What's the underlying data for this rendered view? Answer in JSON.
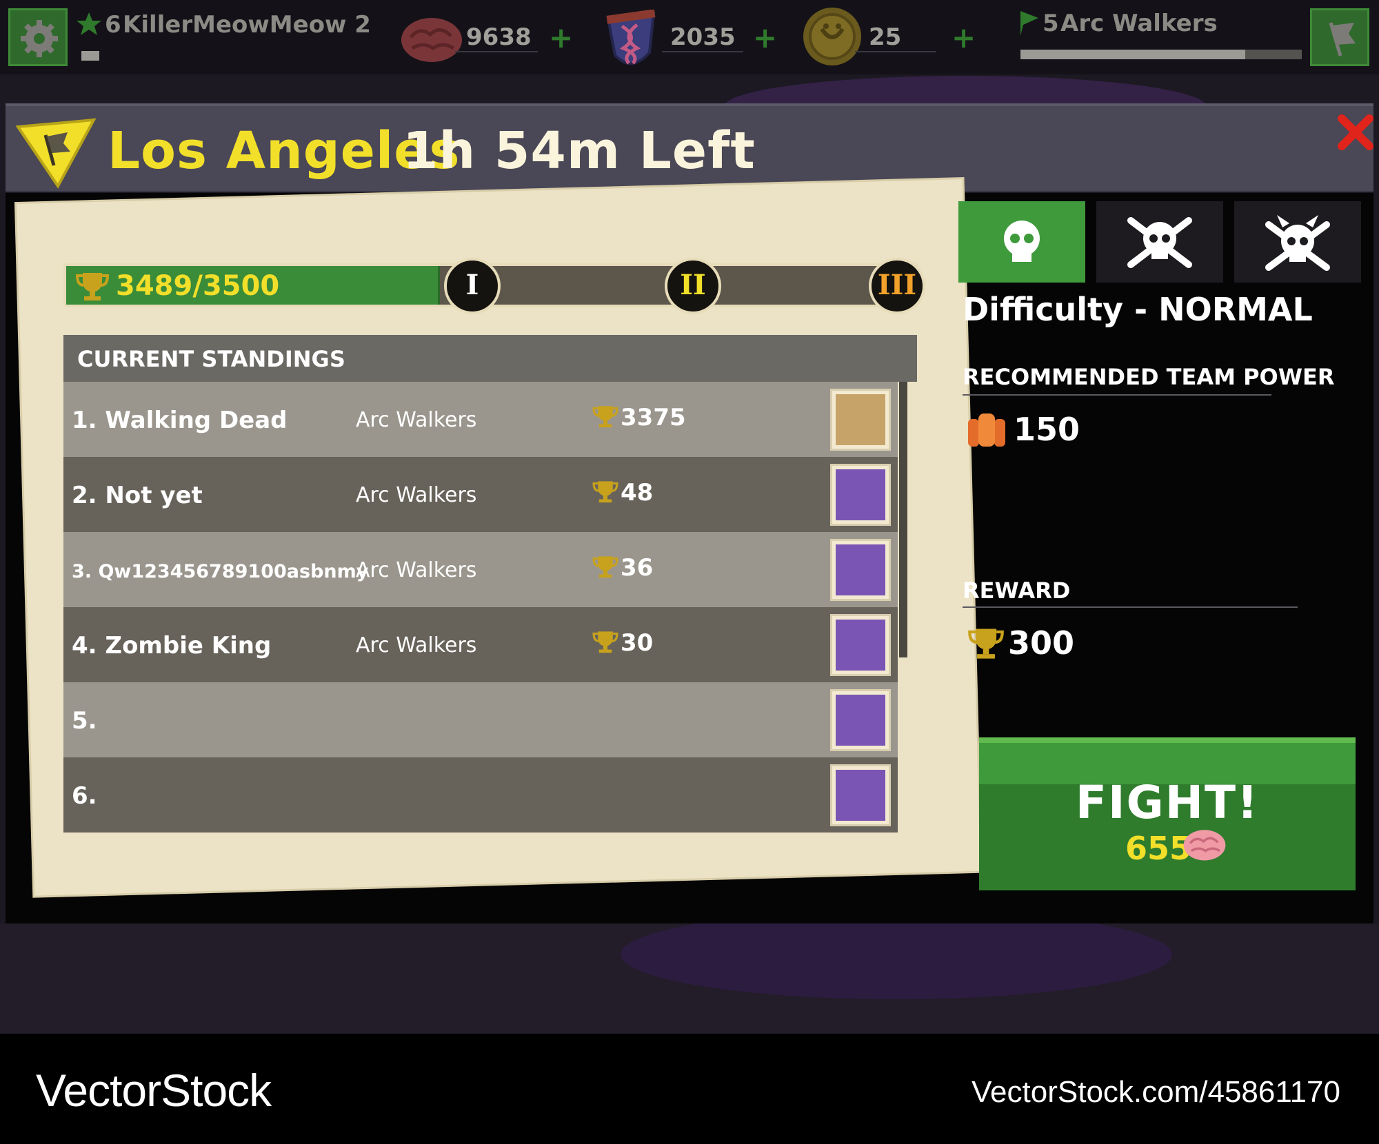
{
  "hud": {
    "player_level": "6",
    "player_name": "KillerMeowMeow 2",
    "player_xp_fraction": 0.2,
    "resources": [
      {
        "icon": "brain-icon",
        "value": "9638"
      },
      {
        "icon": "dna-potion-icon",
        "value": "2035"
      },
      {
        "icon": "gold-coin-icon",
        "value": "25"
      }
    ],
    "team_level": "5",
    "team_name": "Arc Walkers",
    "team_progress_fraction": 0.8
  },
  "header": {
    "city": "Los Angeles",
    "time_left": "1h 54m Left"
  },
  "progress": {
    "text": "3489/3500",
    "fraction": 0.44,
    "milestones": [
      "I",
      "II",
      "III"
    ]
  },
  "standings": {
    "title": "CURRENT STANDINGS",
    "rows": [
      {
        "rank": "1. Walking Dead",
        "team": "Arc Walkers",
        "score": "3375",
        "reward_icon": "treasure-chest-icon"
      },
      {
        "rank": "2. Not yet",
        "team": "Arc Walkers",
        "score": "48",
        "reward_icon": "dna-potion-icon"
      },
      {
        "rank": "3. Qw123456789100asbnmy",
        "team": "Arc Walkers",
        "score": "36",
        "reward_icon": "dna-potion-icon"
      },
      {
        "rank": "4. Zombie King",
        "team": "Arc Walkers",
        "score": "30",
        "reward_icon": "dna-potion-icon"
      },
      {
        "rank": "5.",
        "team": "",
        "score": "",
        "reward_icon": "dna-potion-icon"
      },
      {
        "rank": "6.",
        "team": "",
        "score": "",
        "reward_icon": "dna-potion-icon"
      }
    ]
  },
  "difficulty": {
    "label": "Difficulty - NORMAL",
    "tabs": [
      "skull-icon",
      "skull-crossbones-icon",
      "skull-crossbones-horned-icon"
    ],
    "active_tab": 0
  },
  "recommended": {
    "label": "RECOMMENDED TEAM POWER",
    "value": "150"
  },
  "reward": {
    "label": "REWARD",
    "value": "300"
  },
  "fight": {
    "label": "FIGHT!",
    "cost": "655"
  },
  "watermark": {
    "left": "VectorStock",
    "right": "VectorStock.com/45861170"
  },
  "colors": {
    "accent_yellow": "#f2df2a",
    "button_green": "#3f9a3c",
    "close_red": "#e0241b"
  }
}
